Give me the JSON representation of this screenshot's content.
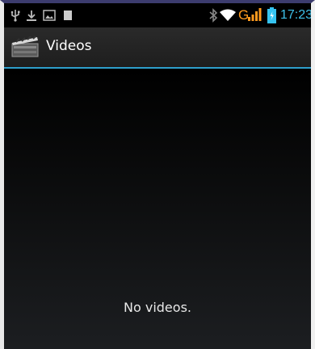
{
  "status_bar": {
    "time": "17:23",
    "network_type": "G",
    "icons": [
      "usb-icon",
      "download-icon",
      "gallery-icon",
      "sdcard-icon",
      "bluetooth-icon",
      "wifi-icon",
      "signal-icon",
      "battery-icon"
    ],
    "colors": {
      "clock": "#3ec1ea",
      "network": "#ff9a1e",
      "battery": "#36c3f0"
    }
  },
  "action_bar": {
    "title": "Videos",
    "icon": "clapperboard-icon",
    "accent_color": "#2e9fcc"
  },
  "content": {
    "empty_message": "No videos."
  }
}
